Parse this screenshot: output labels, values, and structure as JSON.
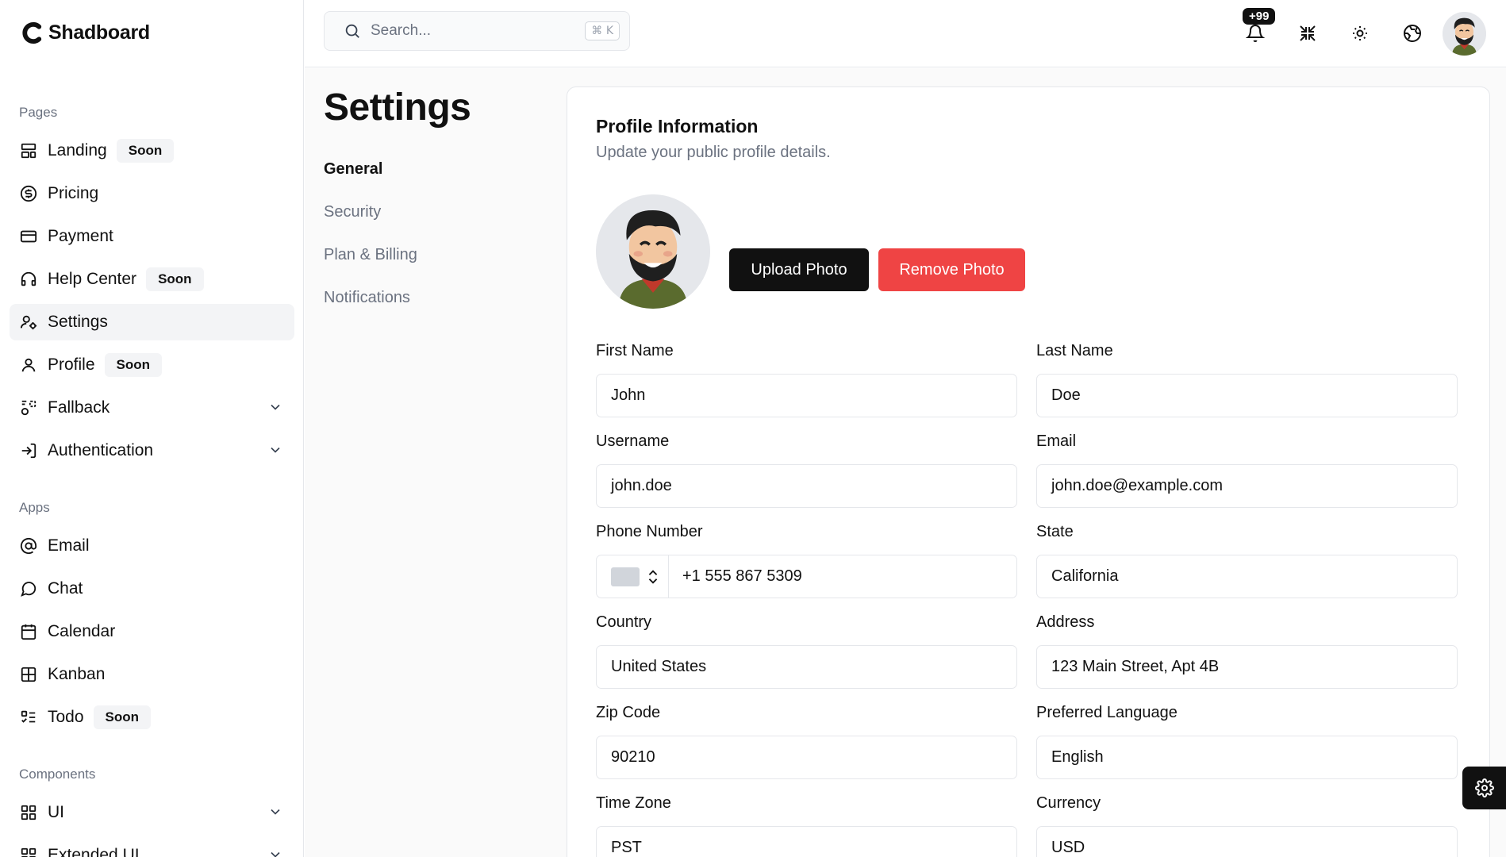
{
  "brand": {
    "name": "Shadboard"
  },
  "sidebar": {
    "sections": [
      {
        "label": "Pages"
      },
      {
        "label": "Apps"
      },
      {
        "label": "Components"
      }
    ],
    "pages": [
      {
        "label": "Landing",
        "icon": "layout-icon",
        "badge": "Soon"
      },
      {
        "label": "Pricing",
        "icon": "dollar-circle-icon"
      },
      {
        "label": "Payment",
        "icon": "credit-card-icon"
      },
      {
        "label": "Help Center",
        "icon": "headphones-icon",
        "badge": "Soon"
      },
      {
        "label": "Settings",
        "icon": "user-cog-icon",
        "active": true
      },
      {
        "label": "Profile",
        "icon": "user-icon",
        "badge": "Soon"
      },
      {
        "label": "Fallback",
        "icon": "shapes-icon",
        "expandable": true
      },
      {
        "label": "Authentication",
        "icon": "log-in-icon",
        "expandable": true
      }
    ],
    "apps": [
      {
        "label": "Email",
        "icon": "at-sign-icon"
      },
      {
        "label": "Chat",
        "icon": "message-circle-icon"
      },
      {
        "label": "Calendar",
        "icon": "calendar-icon"
      },
      {
        "label": "Kanban",
        "icon": "grid-icon"
      },
      {
        "label": "Todo",
        "icon": "list-todo-icon",
        "badge": "Soon"
      }
    ],
    "components": [
      {
        "label": "UI",
        "icon": "layout-grid-icon",
        "expandable": true
      },
      {
        "label": "Extended UI",
        "icon": "layout-grid-icon",
        "expandable": true
      }
    ]
  },
  "topbar": {
    "search_placeholder": "Search...",
    "shortcut_symbol": "⌘",
    "shortcut_key": "K",
    "notification_count": "+99"
  },
  "settings": {
    "title": "Settings",
    "nav": [
      "General",
      "Security",
      "Plan & Billing",
      "Notifications"
    ],
    "active_nav": "General"
  },
  "profile": {
    "title": "Profile Information",
    "description": "Update your public profile details.",
    "upload_label": "Upload Photo",
    "remove_label": "Remove Photo",
    "fields": {
      "first_name": {
        "label": "First Name",
        "value": "John"
      },
      "last_name": {
        "label": "Last Name",
        "value": "Doe"
      },
      "username": {
        "label": "Username",
        "value": "john.doe"
      },
      "email": {
        "label": "Email",
        "value": "john.doe@example.com"
      },
      "phone": {
        "label": "Phone Number",
        "value": "+1 555 867 5309"
      },
      "state": {
        "label": "State",
        "value": "California"
      },
      "country": {
        "label": "Country",
        "value": "United States"
      },
      "address": {
        "label": "Address",
        "value": "123 Main Street, Apt 4B"
      },
      "zip": {
        "label": "Zip Code",
        "value": "90210"
      },
      "language": {
        "label": "Preferred Language",
        "value": "English"
      },
      "timezone": {
        "label": "Time Zone",
        "value": "PST"
      },
      "currency": {
        "label": "Currency",
        "value": "USD"
      }
    }
  },
  "colors": {
    "primary": "#111111",
    "danger": "#ef4444",
    "muted": "#6b7280",
    "border": "#e5e7eb",
    "active_bg": "#f3f4f6"
  }
}
